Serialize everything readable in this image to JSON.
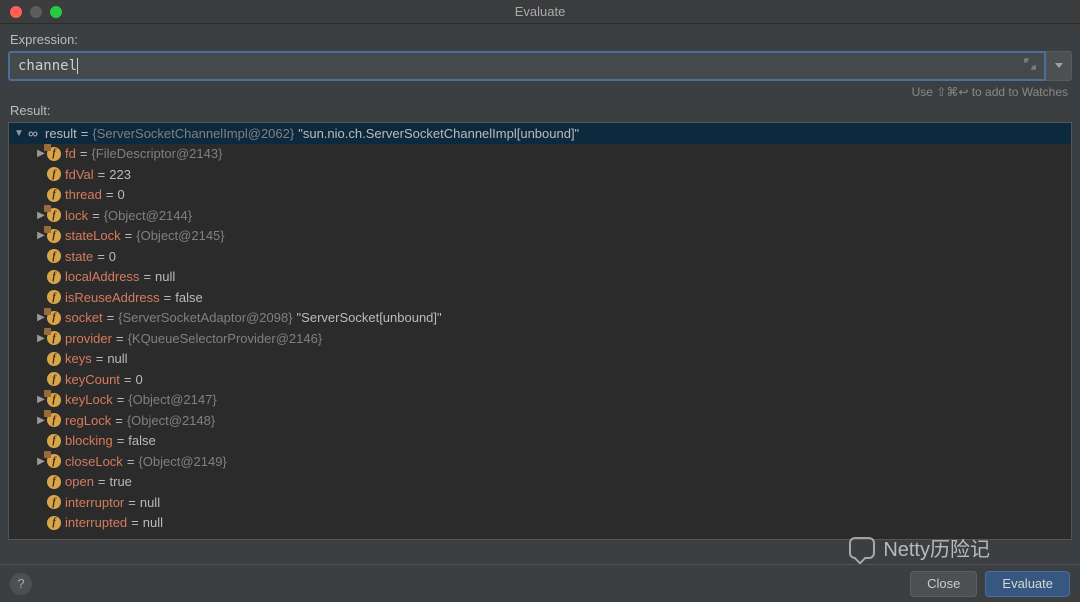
{
  "window": {
    "title": "Evaluate"
  },
  "labels": {
    "expression": "Expression:",
    "result": "Result:",
    "hint": "Use ⇧⌘↩ to add to Watches"
  },
  "expression": {
    "value": "channel"
  },
  "buttons": {
    "close": "Close",
    "evaluate": "Evaluate"
  },
  "tree": {
    "root": {
      "name": "result",
      "value": "{ServerSocketChannelImpl@2062}",
      "string": "\"sun.nio.ch.ServerSocketChannelImpl[unbound]\""
    },
    "fields": [
      {
        "name": "fd",
        "expandable": true,
        "locked": true,
        "gray": "{FileDescriptor@2143}",
        "white": ""
      },
      {
        "name": "fdVal",
        "expandable": false,
        "locked": false,
        "gray": "",
        "white": "223"
      },
      {
        "name": "thread",
        "expandable": false,
        "locked": false,
        "gray": "",
        "white": "0"
      },
      {
        "name": "lock",
        "expandable": true,
        "locked": true,
        "gray": "{Object@2144}",
        "white": ""
      },
      {
        "name": "stateLock",
        "expandable": true,
        "locked": true,
        "gray": "{Object@2145}",
        "white": ""
      },
      {
        "name": "state",
        "expandable": false,
        "locked": false,
        "gray": "",
        "white": "0"
      },
      {
        "name": "localAddress",
        "expandable": false,
        "locked": false,
        "gray": "",
        "white": "null"
      },
      {
        "name": "isReuseAddress",
        "expandable": false,
        "locked": false,
        "gray": "",
        "white": "false"
      },
      {
        "name": "socket",
        "expandable": true,
        "locked": true,
        "gray": "{ServerSocketAdaptor@2098}",
        "white": "\"ServerSocket[unbound]\""
      },
      {
        "name": "provider",
        "expandable": true,
        "locked": true,
        "gray": "{KQueueSelectorProvider@2146}",
        "white": ""
      },
      {
        "name": "keys",
        "expandable": false,
        "locked": false,
        "gray": "",
        "white": "null"
      },
      {
        "name": "keyCount",
        "expandable": false,
        "locked": false,
        "gray": "",
        "white": "0"
      },
      {
        "name": "keyLock",
        "expandable": true,
        "locked": true,
        "gray": "{Object@2147}",
        "white": ""
      },
      {
        "name": "regLock",
        "expandable": true,
        "locked": true,
        "gray": "{Object@2148}",
        "white": ""
      },
      {
        "name": "blocking",
        "expandable": false,
        "locked": false,
        "gray": "",
        "white": "false"
      },
      {
        "name": "closeLock",
        "expandable": true,
        "locked": true,
        "gray": "{Object@2149}",
        "white": ""
      },
      {
        "name": "open",
        "expandable": false,
        "locked": false,
        "gray": "",
        "white": "true"
      },
      {
        "name": "interruptor",
        "expandable": false,
        "locked": false,
        "gray": "",
        "white": "null"
      },
      {
        "name": "interrupted",
        "expandable": false,
        "locked": false,
        "gray": "",
        "white": "null"
      }
    ]
  },
  "watermark": "Netty历险记"
}
